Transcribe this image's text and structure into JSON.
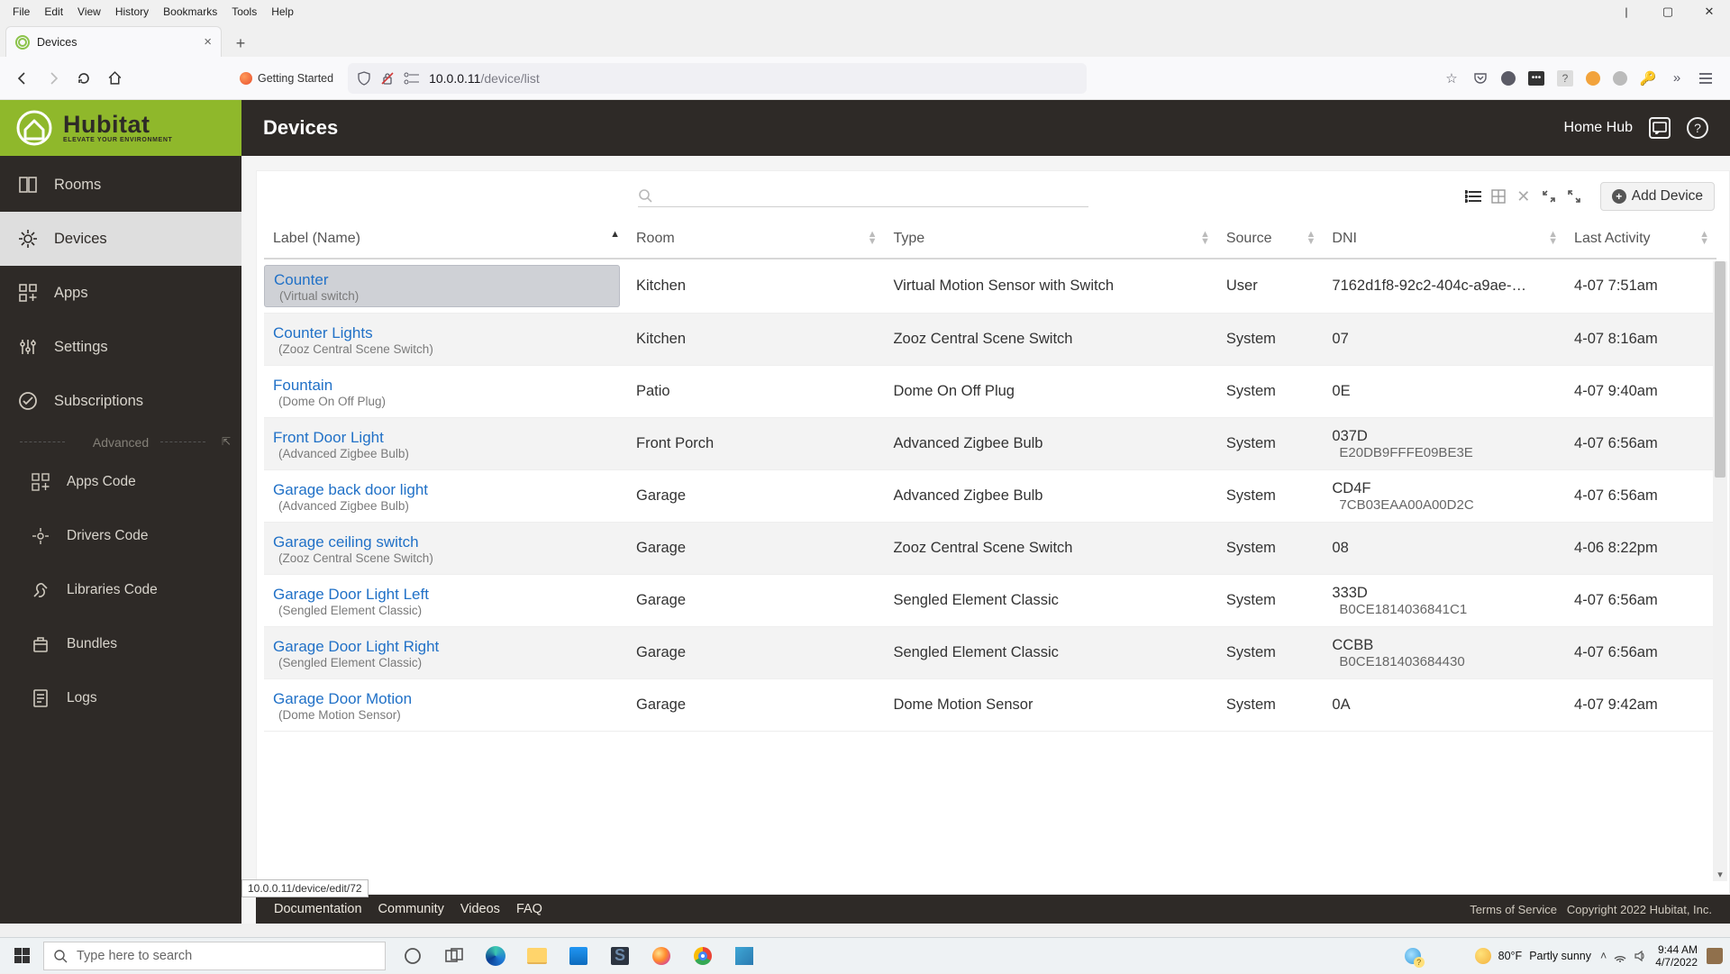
{
  "browser": {
    "menus": [
      "File",
      "Edit",
      "View",
      "History",
      "Bookmarks",
      "Tools",
      "Help"
    ],
    "tab_title": "Devices",
    "getting_started": "Getting Started",
    "url_host": "10.0.0.11",
    "url_path": "/device/list",
    "status_link": "10.0.0.11/device/edit/72"
  },
  "header": {
    "brand": "Hubitat",
    "tagline": "ELEVATE YOUR ENVIRONMENT",
    "page_title": "Devices",
    "hub_name": "Home Hub"
  },
  "sidebar": {
    "items": [
      {
        "label": "Rooms"
      },
      {
        "label": "Devices"
      },
      {
        "label": "Apps"
      },
      {
        "label": "Settings"
      },
      {
        "label": "Subscriptions"
      }
    ],
    "advanced_label": "Advanced",
    "advanced": [
      {
        "label": "Apps Code"
      },
      {
        "label": "Drivers Code"
      },
      {
        "label": "Libraries Code"
      },
      {
        "label": "Bundles"
      },
      {
        "label": "Logs"
      }
    ]
  },
  "toolbar": {
    "add_device": "Add Device"
  },
  "table": {
    "columns": {
      "label": "Label (Name)",
      "room": "Room",
      "type": "Type",
      "source": "Source",
      "dni": "DNI",
      "last": "Last Activity"
    },
    "rows": [
      {
        "name": "Counter",
        "sub": "(Virtual switch)",
        "room": "Kitchen",
        "type": "Virtual Motion Sensor with Switch",
        "source": "User",
        "dni": "7162d1f8-92c2-404c-a9ae-…",
        "dni2": "",
        "last": "4-07 7:51am",
        "selected": true
      },
      {
        "name": "Counter Lights",
        "sub": "(Zooz Central Scene Switch)",
        "room": "Kitchen",
        "type": "Zooz Central Scene Switch",
        "source": "System",
        "dni": "07",
        "dni2": "",
        "last": "4-07 8:16am"
      },
      {
        "name": "Fountain",
        "sub": "(Dome On Off Plug)",
        "room": "Patio",
        "type": "Dome On Off Plug",
        "source": "System",
        "dni": "0E",
        "dni2": "",
        "last": "4-07 9:40am"
      },
      {
        "name": "Front Door Light",
        "sub": "(Advanced Zigbee Bulb)",
        "room": "Front Porch",
        "type": "Advanced Zigbee Bulb",
        "source": "System",
        "dni": "037D",
        "dni2": "E20DB9FFFE09BE3E",
        "last": "4-07 6:56am"
      },
      {
        "name": "Garage back door light",
        "sub": "(Advanced Zigbee Bulb)",
        "room": "Garage",
        "type": "Advanced Zigbee Bulb",
        "source": "System",
        "dni": "CD4F",
        "dni2": "7CB03EAA00A00D2C",
        "last": "4-07 6:56am"
      },
      {
        "name": "Garage ceiling switch",
        "sub": "(Zooz Central Scene Switch)",
        "room": "Garage",
        "type": "Zooz Central Scene Switch",
        "source": "System",
        "dni": "08",
        "dni2": "",
        "last": "4-06 8:22pm"
      },
      {
        "name": "Garage Door Light Left",
        "sub": "(Sengled Element Classic)",
        "room": "Garage",
        "type": "Sengled Element Classic",
        "source": "System",
        "dni": "333D",
        "dni2": "B0CE1814036841C1",
        "last": "4-07 6:56am"
      },
      {
        "name": "Garage Door Light Right",
        "sub": "(Sengled Element Classic)",
        "room": "Garage",
        "type": "Sengled Element Classic",
        "source": "System",
        "dni": "CCBB",
        "dni2": "B0CE181403684430",
        "last": "4-07 6:56am"
      },
      {
        "name": "Garage Door Motion",
        "sub": "(Dome Motion Sensor)",
        "room": "Garage",
        "type": "Dome Motion Sensor",
        "source": "System",
        "dni": "0A",
        "dni2": "",
        "last": "4-07 9:42am"
      }
    ]
  },
  "footer": {
    "links": [
      "Documentation",
      "Community",
      "Videos",
      "FAQ"
    ],
    "tos": "Terms of Service",
    "copyright": "Copyright 2022 Hubitat, Inc."
  },
  "taskbar": {
    "search_placeholder": "Type here to search",
    "weather_temp": "80°F",
    "weather_desc": "Partly sunny",
    "time": "9:44 AM",
    "date": "4/7/2022"
  }
}
